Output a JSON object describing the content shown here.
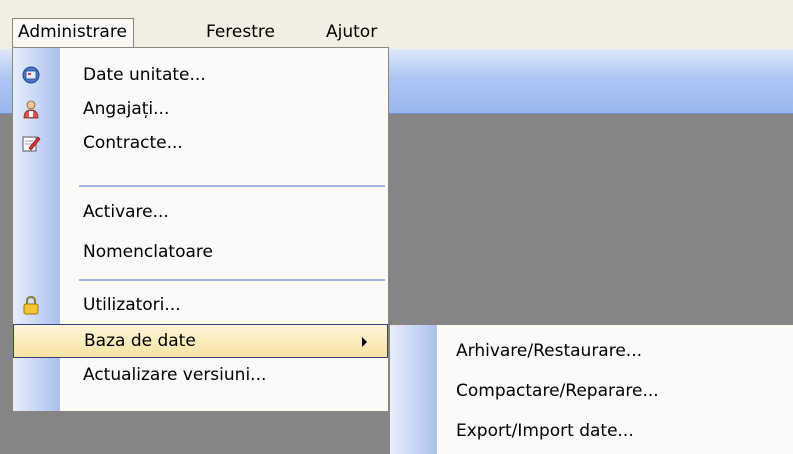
{
  "menubar": {
    "items": [
      {
        "label": "Administrare"
      },
      {
        "label": "Ferestre"
      },
      {
        "label": "Ajutor"
      }
    ]
  },
  "menu": {
    "items": [
      {
        "label": "Date unitate...",
        "icon": "database-icon"
      },
      {
        "label": "Angajați...",
        "icon": "person-icon"
      },
      {
        "label": "Contracte...",
        "icon": "document-edit-icon"
      },
      {
        "label": "Activare..."
      },
      {
        "label": "Nomenclatoare"
      },
      {
        "label": "Utilizatori...",
        "icon": "lock-icon"
      },
      {
        "label": "Baza de date"
      },
      {
        "label": "Actualizare versiuni..."
      }
    ]
  },
  "submenu": {
    "items": [
      {
        "label": "Arhivare/Restaurare..."
      },
      {
        "label": "Compactare/Reparare..."
      },
      {
        "label": "Export/Import date..."
      }
    ]
  },
  "colors": {
    "highlight": "#f8e2a3",
    "highlight_border": "#3a3d80",
    "gutter": "#a9c0ee",
    "workspace": "#858585"
  }
}
